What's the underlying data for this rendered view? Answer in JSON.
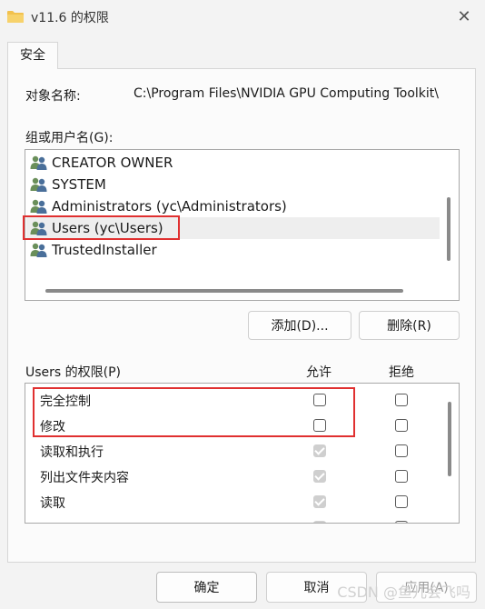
{
  "window": {
    "title": "v11.6 的权限",
    "close_glyph": "✕"
  },
  "tabs": [
    {
      "label": "安全"
    }
  ],
  "object": {
    "label": "对象名称:",
    "value": "C:\\Program Files\\NVIDIA GPU Computing Toolkit\\"
  },
  "groups": {
    "label": "组或用户名(G):",
    "items": [
      {
        "name": "CREATOR OWNER",
        "icon": "users-icon",
        "selected": false
      },
      {
        "name": "SYSTEM",
        "icon": "users-icon",
        "selected": false
      },
      {
        "name": "Administrators (yc\\Administrators)",
        "icon": "users-icon",
        "selected": false
      },
      {
        "name": "Users (yc\\Users)",
        "icon": "users-icon",
        "selected": true
      },
      {
        "name": "TrustedInstaller",
        "icon": "users-icon",
        "selected": false
      }
    ]
  },
  "buttons": {
    "add": "添加(D)...",
    "remove": "删除(R)",
    "ok": "确定",
    "cancel": "取消",
    "apply": "应用(A)"
  },
  "permissions": {
    "label": "Users 的权限(P)",
    "allow_header": "允许",
    "deny_header": "拒绝",
    "rows": [
      {
        "name": "完全控制",
        "allow": false,
        "allow_disabled": false,
        "deny": false
      },
      {
        "name": "修改",
        "allow": false,
        "allow_disabled": false,
        "deny": false
      },
      {
        "name": "读取和执行",
        "allow": true,
        "allow_disabled": true,
        "deny": false
      },
      {
        "name": "列出文件夹内容",
        "allow": true,
        "allow_disabled": true,
        "deny": false
      },
      {
        "name": "读取",
        "allow": true,
        "allow_disabled": true,
        "deny": false
      }
    ]
  },
  "watermark": "CSDN @鱼儿会飞吗",
  "colors": {
    "highlight_box": "#e03030",
    "folder": "#f2c14e"
  }
}
